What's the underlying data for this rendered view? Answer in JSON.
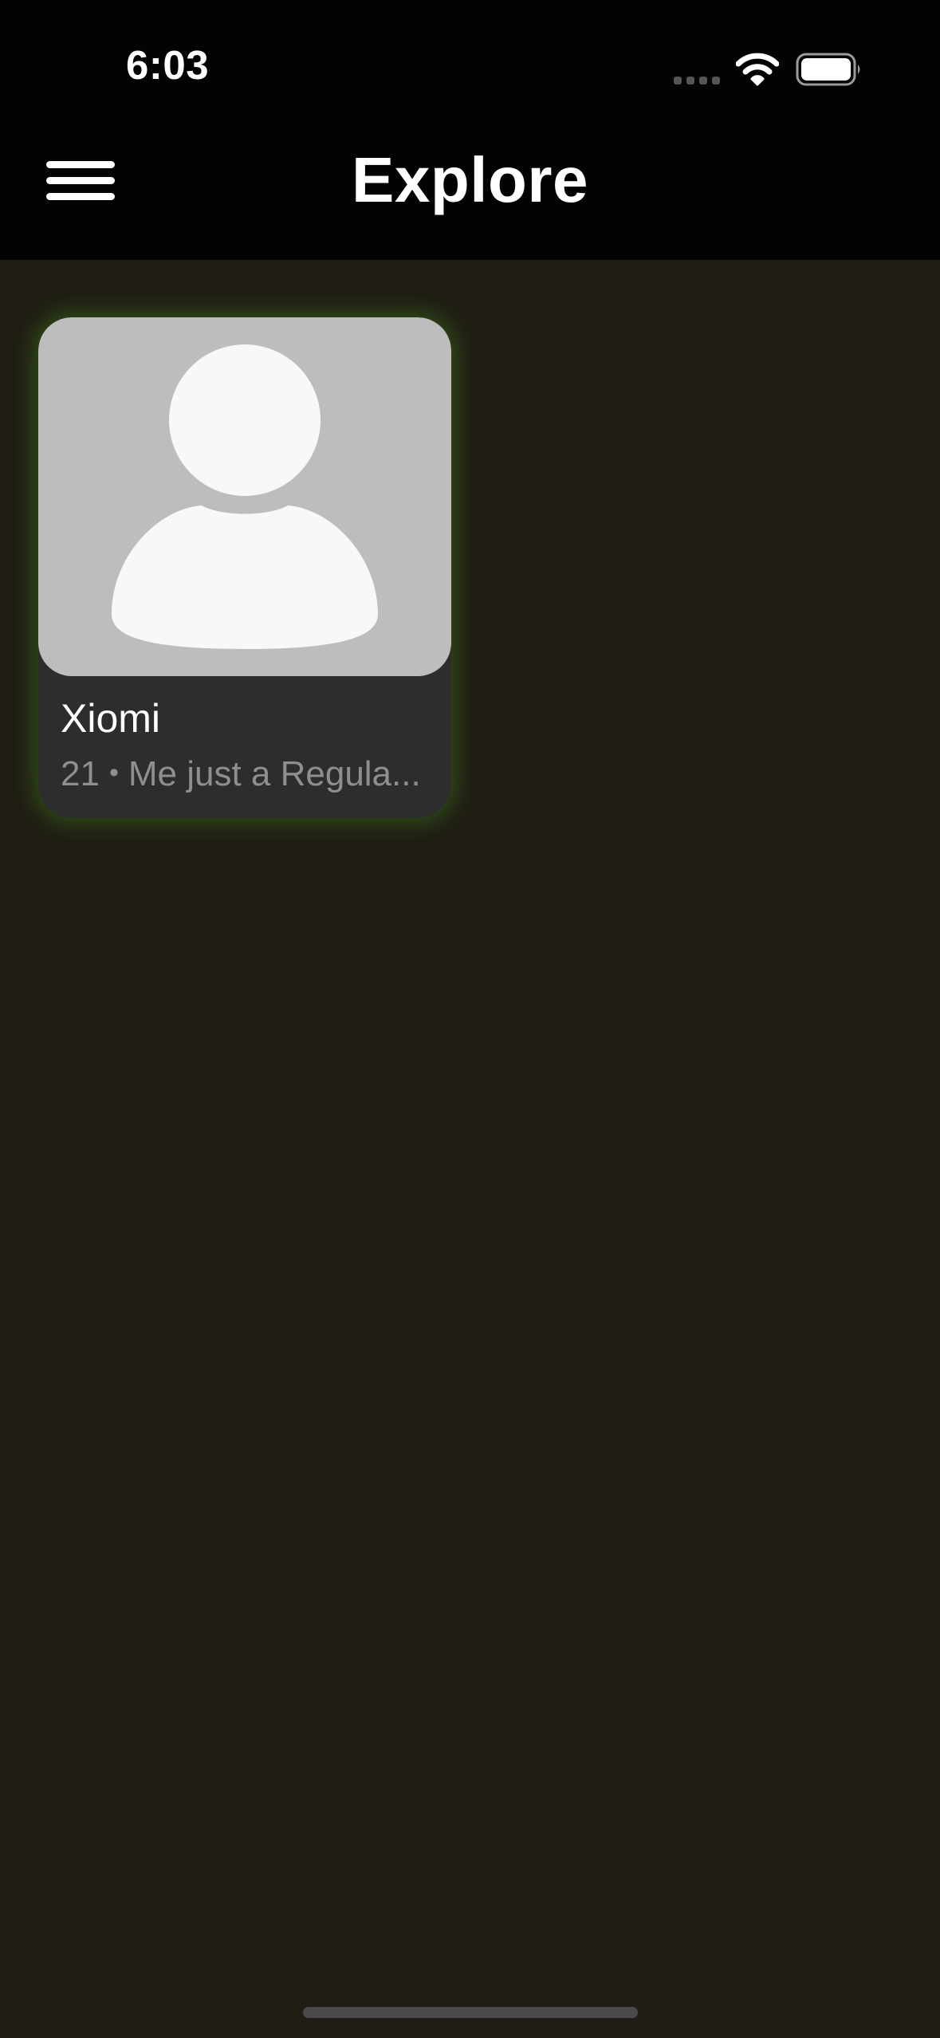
{
  "status_bar": {
    "time": "6:03"
  },
  "nav": {
    "title": "Explore",
    "menu_icon": "hamburger-menu-icon"
  },
  "cards": [
    {
      "name": "Xiomi",
      "age": "21",
      "separator": "•",
      "bio": "Me just a Regula...",
      "avatar_icon": "default-person-icon"
    }
  ],
  "colors": {
    "background": "#201e14",
    "top_bar": "#030303",
    "card_background": "#2d2d2d",
    "avatar_background": "#bdbdbd",
    "card_glow": "#5ac828",
    "subtitle_text": "#8e8e93"
  }
}
